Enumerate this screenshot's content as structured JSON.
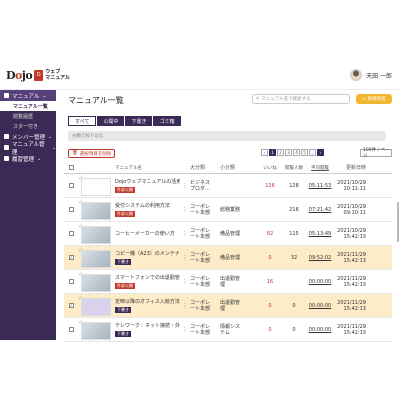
{
  "app": {
    "logo_mark": "Dojo",
    "logo_badge": "D",
    "logo_text": "ウェブ\nマニュアル",
    "user_name": "天田 一郎"
  },
  "sidebar": {
    "items": [
      {
        "label": "マニュアル",
        "has_chevron": true
      },
      {
        "label": "メンバー管理",
        "has_chevron": true
      },
      {
        "label": "マニュアル管理",
        "has_chevron": true
      },
      {
        "label": "履習管理",
        "has_chevron": true
      }
    ],
    "manual_sub": [
      {
        "label": "マニュアル一覧",
        "selected": true
      },
      {
        "label": "閲覧履歴",
        "selected": false
      },
      {
        "label": "スター付き",
        "selected": false
      }
    ]
  },
  "main": {
    "title": "マニュアル一覧",
    "search_placeholder": "マニュアル名で検索する",
    "new_button": "+ 新規作成",
    "tabs": [
      "すべて",
      "公開中",
      "下書き",
      "ゴミ箱"
    ],
    "tag_placeholder": "分類で絞り込む",
    "delete_button": "選択項目を削除",
    "pages": [
      "1",
      "2",
      "3",
      "4",
      "5",
      "...",
      "›"
    ],
    "current_page": "1",
    "pager_prev": "‹",
    "per_page": "100件 / ページ"
  },
  "table": {
    "headers": [
      "マニュアル名",
      "大分類",
      "小分類",
      "いいね",
      "閲覧人数",
      "平均閲覧",
      "更新日時"
    ],
    "rows": [
      {
        "name": "Dojoウェブマニュアルの活用",
        "badge": "外部公開",
        "l1": "ビジネス\nプロダ...",
        "l2": "",
        "likes": "126",
        "views": "128",
        "avg": "05:11:53",
        "date": "2021/10/29\n10:11:11",
        "checked": false,
        "hl": false,
        "thumb": "logo"
      },
      {
        "name": "受付システムの利用方法",
        "badge": "外部公開",
        "l1": "コーポレ\nート本部",
        "l2": "総務業務",
        "likes": "",
        "views": "216",
        "avg": "07:21:42",
        "date": "2021/10/29\n09:10:11",
        "checked": false,
        "hl": false,
        "thumb": "img"
      },
      {
        "name": "コーヒーメーカーの使い方",
        "badge": "",
        "l1": "コーポレ\nート本部",
        "l2": "備品管理",
        "likes": "82",
        "views": "115",
        "avg": "05:13:49",
        "date": "2021/10/29\n15:42:13",
        "checked": false,
        "hl": false,
        "thumb": "img"
      },
      {
        "name": "コピー機（A23）のメンテナ...",
        "badge": "下書き",
        "l1": "コーポレ\nート本部",
        "l2": "備品管理",
        "likes": "0",
        "views": "32",
        "avg": "09:52:02",
        "date": "2021/11/29\n15:42:13",
        "checked": true,
        "hl": true,
        "thumb": "img"
      },
      {
        "name": "スマートフォンでの出退勤管理",
        "badge": "外部公開",
        "l1": "コーポレ\nート本部",
        "l2": "出退勤管\n理",
        "likes": "16",
        "views": "",
        "avg": "00:00:00",
        "date": "2021/11/29\n15:42:13",
        "checked": false,
        "hl": false,
        "thumb": "img"
      },
      {
        "name": "定時以降のオフィス入館方法",
        "badge": "下書き",
        "l1": "コーポレ\nート本部",
        "l2": "出退勤管\n理",
        "likes": "0",
        "views": "0",
        "avg": "00:00:00",
        "date": "2021/11/29\n15:42:13",
        "checked": true,
        "hl": true,
        "thumb": "ph"
      },
      {
        "name": "テレワーク：ネット接続・外...",
        "badge": "下書き",
        "l1": "コーポレ\nート本部",
        "l2": "情報シス\nテム",
        "likes": "0",
        "views": "0",
        "avg": "00:00:00",
        "date": "2021/11/29\n15:42:13",
        "checked": false,
        "hl": false,
        "thumb": "img"
      }
    ]
  },
  "colors": {
    "sidebar": "#3b2a56",
    "accent_yellow": "#f2b630",
    "red": "#c0392b",
    "highlight": "#fdecc8"
  }
}
